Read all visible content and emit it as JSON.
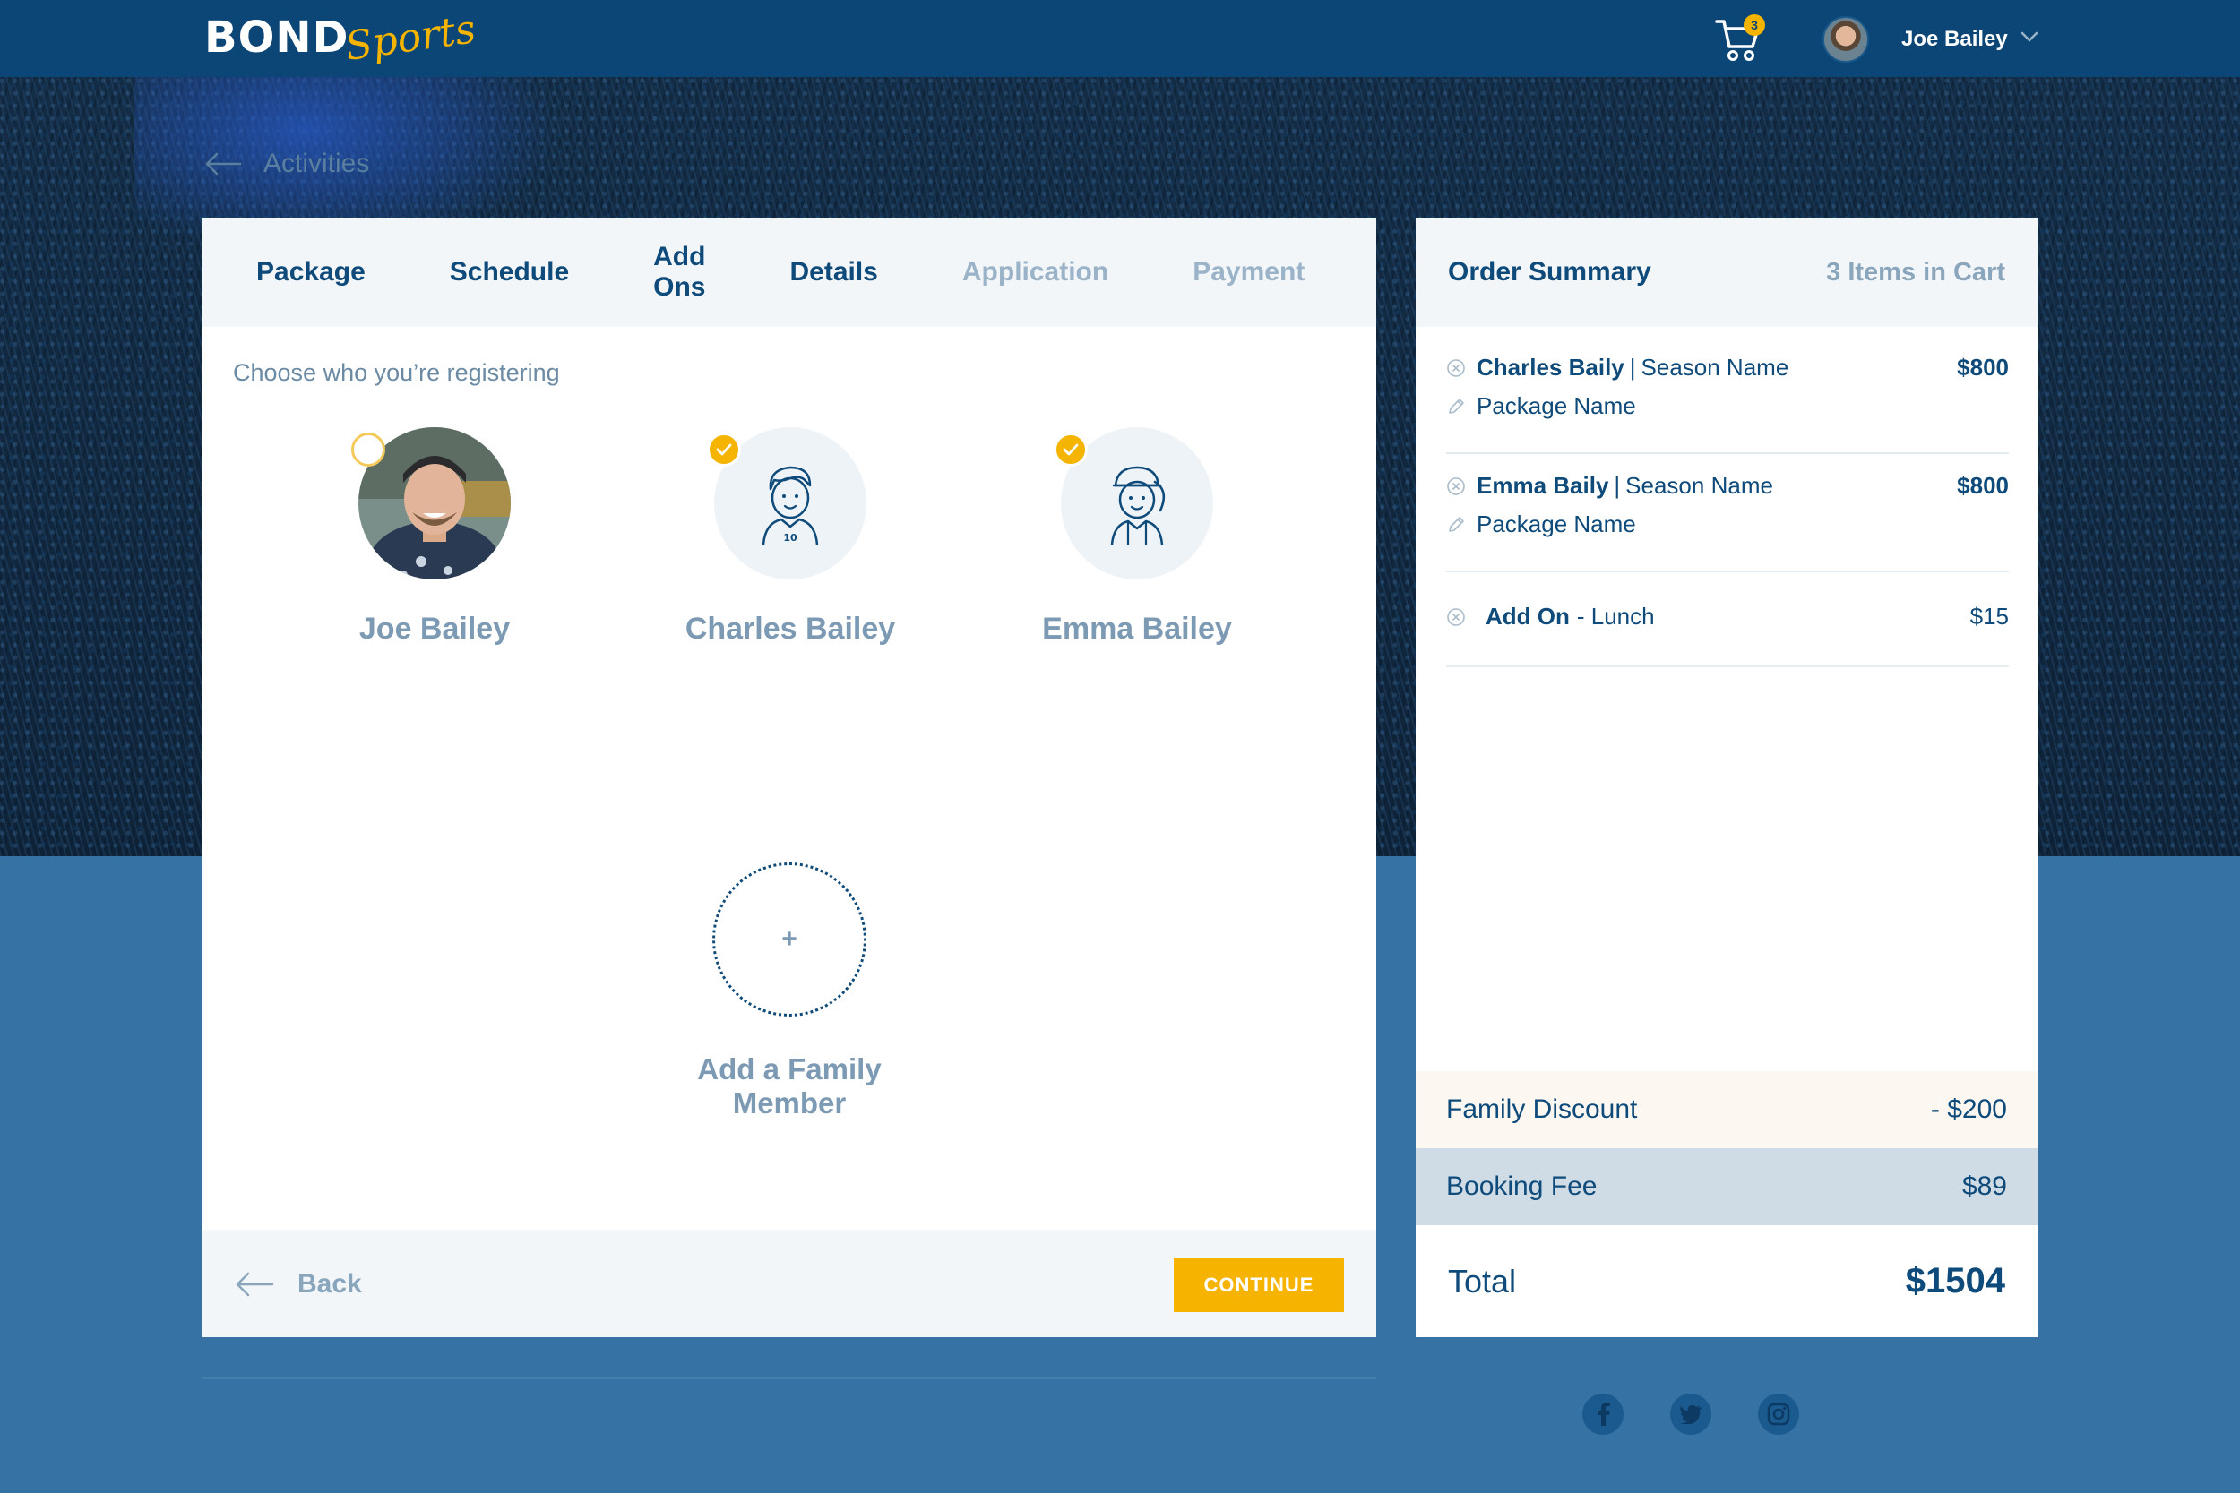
{
  "header": {
    "logo_main": "BOND",
    "logo_script": "Sports",
    "cart_count": "3",
    "user_name": "Joe Bailey"
  },
  "breadcrumb": {
    "label": "Activities"
  },
  "steps": [
    {
      "label": "Package",
      "state": "done"
    },
    {
      "label": "Schedule",
      "state": "done"
    },
    {
      "label": "Add Ons",
      "state": "done"
    },
    {
      "label": "Details",
      "state": "current"
    },
    {
      "label": "Application",
      "state": "disabled"
    },
    {
      "label": "Payment",
      "state": "disabled"
    }
  ],
  "registration": {
    "prompt": "Choose who you’re registering",
    "members": [
      {
        "name": "Joe Bailey",
        "selected": false
      },
      {
        "name": "Charles Bailey",
        "selected": true
      },
      {
        "name": "Emma Bailey",
        "selected": true
      }
    ],
    "add_plus": "+",
    "add_label": "Add a Family Member"
  },
  "footer": {
    "back_label": "Back",
    "continue_label": "CONTINUE"
  },
  "order": {
    "title": "Order Summary",
    "count_label": "3 Items in Cart",
    "items": [
      {
        "name": "Charles Baily",
        "separator": "|",
        "season": "Season Name",
        "package": "Package Name",
        "price": "$800"
      },
      {
        "name": "Emma Baily",
        "separator": "|",
        "season": "Season Name",
        "package": "Package Name",
        "price": "$800"
      }
    ],
    "addon": {
      "name": "Add On",
      "detail": "- Lunch",
      "price": "$15"
    },
    "discount": {
      "label": "Family Discount",
      "value": "- $200"
    },
    "fee": {
      "label": "Booking Fee",
      "value": "$89"
    },
    "total": {
      "label": "Total",
      "value": "$1504"
    }
  },
  "colors": {
    "brand_navy": "#0c4676",
    "accent_yellow": "#f4b400",
    "page_blue": "#3672a4"
  }
}
